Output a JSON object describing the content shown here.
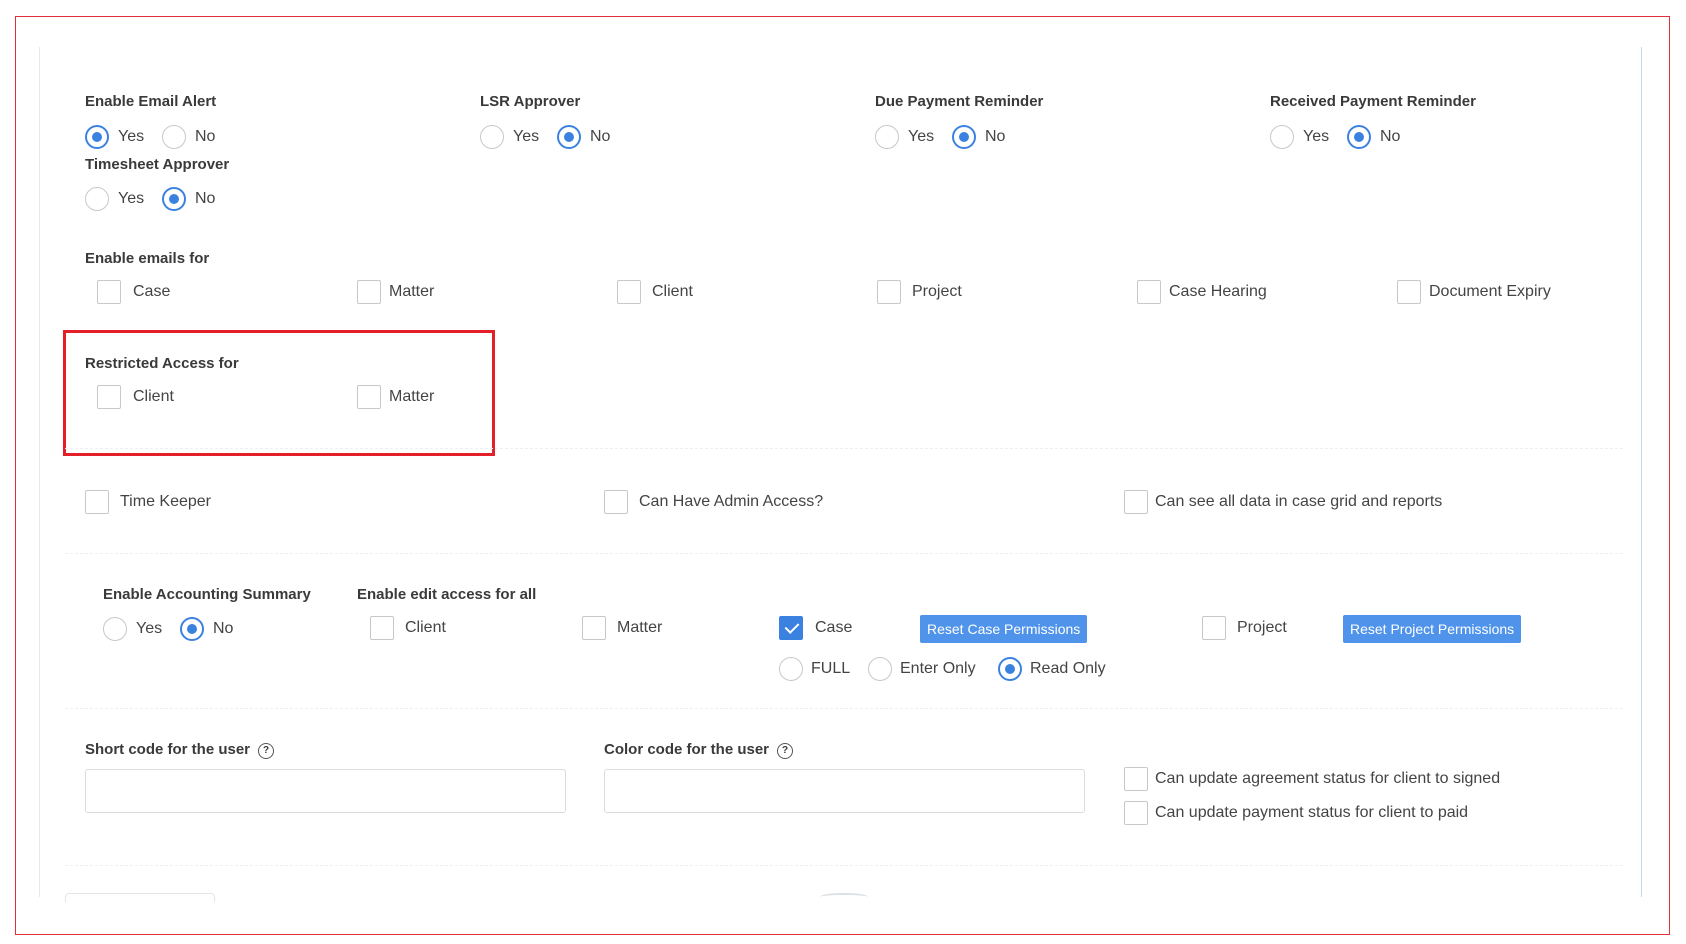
{
  "alerts": {
    "email_alert": {
      "label": "Enable Email Alert",
      "yes": "Yes",
      "no": "No",
      "selected": "Yes"
    },
    "lsr_approver": {
      "label": "LSR Approver",
      "yes": "Yes",
      "no": "No",
      "selected": "No"
    },
    "due_payment": {
      "label": "Due Payment Reminder",
      "yes": "Yes",
      "no": "No",
      "selected": "No"
    },
    "received_payment": {
      "label": "Received Payment Reminder",
      "yes": "Yes",
      "no": "No",
      "selected": "No"
    },
    "timesheet_approver": {
      "label": "Timesheet Approver",
      "yes": "Yes",
      "no": "No",
      "selected": "No"
    }
  },
  "enable_emails": {
    "label": "Enable emails for",
    "items": [
      "Case",
      "Matter",
      "Client",
      "Project",
      "Case Hearing",
      "Document Expiry"
    ]
  },
  "restricted_access": {
    "label": "Restricted Access for",
    "items": [
      "Client",
      "Matter"
    ]
  },
  "flags": {
    "time_keeper": "Time Keeper",
    "admin_access": "Can Have Admin Access?",
    "see_all_data": "Can see all data in case grid and reports"
  },
  "accounting": {
    "label": "Enable Accounting Summary",
    "yes": "Yes",
    "no": "No",
    "selected": "No"
  },
  "edit_access": {
    "label": "Enable edit access for all",
    "client": "Client",
    "matter": "Matter",
    "case": "Case",
    "case_checked": true,
    "project": "Project",
    "reset_case": "Reset Case Permissions",
    "reset_project": "Reset Project Permissions",
    "case_modes": {
      "full": "FULL",
      "enter_only": "Enter Only",
      "read_only": "Read Only",
      "selected": "Read Only"
    }
  },
  "user_codes": {
    "short_code_label": "Short code for the user",
    "color_code_label": "Color code for the user",
    "help_glyph": "?",
    "short_code_value": "",
    "color_code_value": ""
  },
  "client_permissions": {
    "agreement_signed": "Can update agreement status for client to signed",
    "payment_paid": "Can update payment status for client to paid"
  },
  "colors": {
    "accent": "#3b82e0",
    "button": "#4f93ea",
    "highlight": "#e3202a"
  }
}
